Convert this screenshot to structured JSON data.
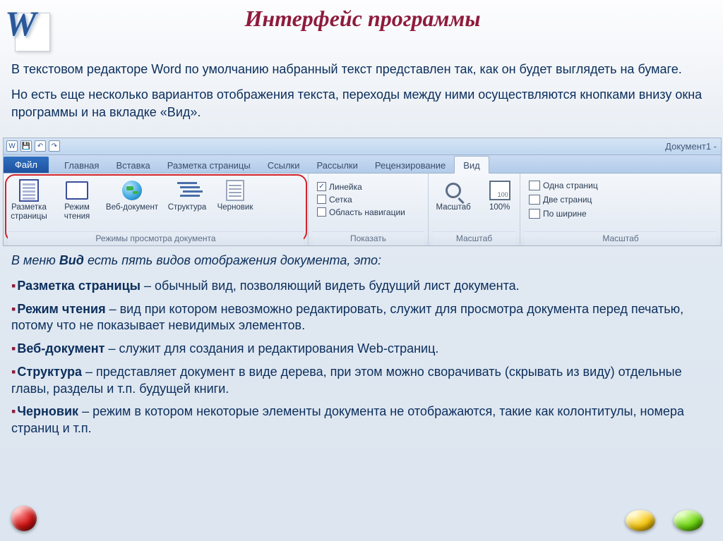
{
  "title": "Интерфейс программы",
  "intro": {
    "p1": "В текстовом редакторе Word по умолчанию набранный текст представлен так, как он будет выглядеть на бумаге.",
    "p2": "Но есть еще несколько вариантов отображения текста, переходы между ними осуществляются кнопками внизу окна программы и на вкладке «Вид»."
  },
  "ribbon": {
    "doc_title": "Документ1 -",
    "file_tab": "Файл",
    "tabs": [
      "Главная",
      "Вставка",
      "Разметка страницы",
      "Ссылки",
      "Рассылки",
      "Рецензирование",
      "Вид"
    ],
    "groups": {
      "views": {
        "label": "Режимы просмотра документа",
        "buttons": [
          {
            "label": "Разметка страницы"
          },
          {
            "label": "Режим чтения"
          },
          {
            "label": "Веб-документ"
          },
          {
            "label": "Структура"
          },
          {
            "label": "Черновик"
          }
        ]
      },
      "show": {
        "label": "Показать",
        "checks": [
          {
            "label": "Линейка",
            "checked": true
          },
          {
            "label": "Сетка",
            "checked": false
          },
          {
            "label": "Область навигации",
            "checked": false
          }
        ]
      },
      "zoom": {
        "label": "Масштаб",
        "btn_zoom": "Масштаб",
        "btn_100": "100%",
        "rows": [
          "Одна страниц",
          "Две страниц",
          "По ширине"
        ]
      }
    }
  },
  "menu_line": {
    "pre": "В меню ",
    "bold": "Вид",
    "post": " есть пять видов отображения документа, это:"
  },
  "modes": [
    {
      "lead": "Разметка страницы",
      "rest": " – обычный вид, позволяющий видеть будущий лист документа."
    },
    {
      "lead": "Режим чтения",
      "rest": " – вид при котором невозможно редактировать, служит для просмотра документа перед печатью, потому что не показывает невидимых элементов."
    },
    {
      "lead": "Веб-документ",
      "rest": " – служит для создания и редактирования Web-страниц."
    },
    {
      "lead": "Структура",
      "rest": " – представляет документ в виде дерева, при этом можно сворачивать (скрывать из виду) отдельные главы, разделы и т.п. будущей книги."
    },
    {
      "lead": "Черновик",
      "rest": " – режим в котором некоторые элементы документа не отображаются, такие как колонтитулы, номера страниц и т.п."
    }
  ]
}
